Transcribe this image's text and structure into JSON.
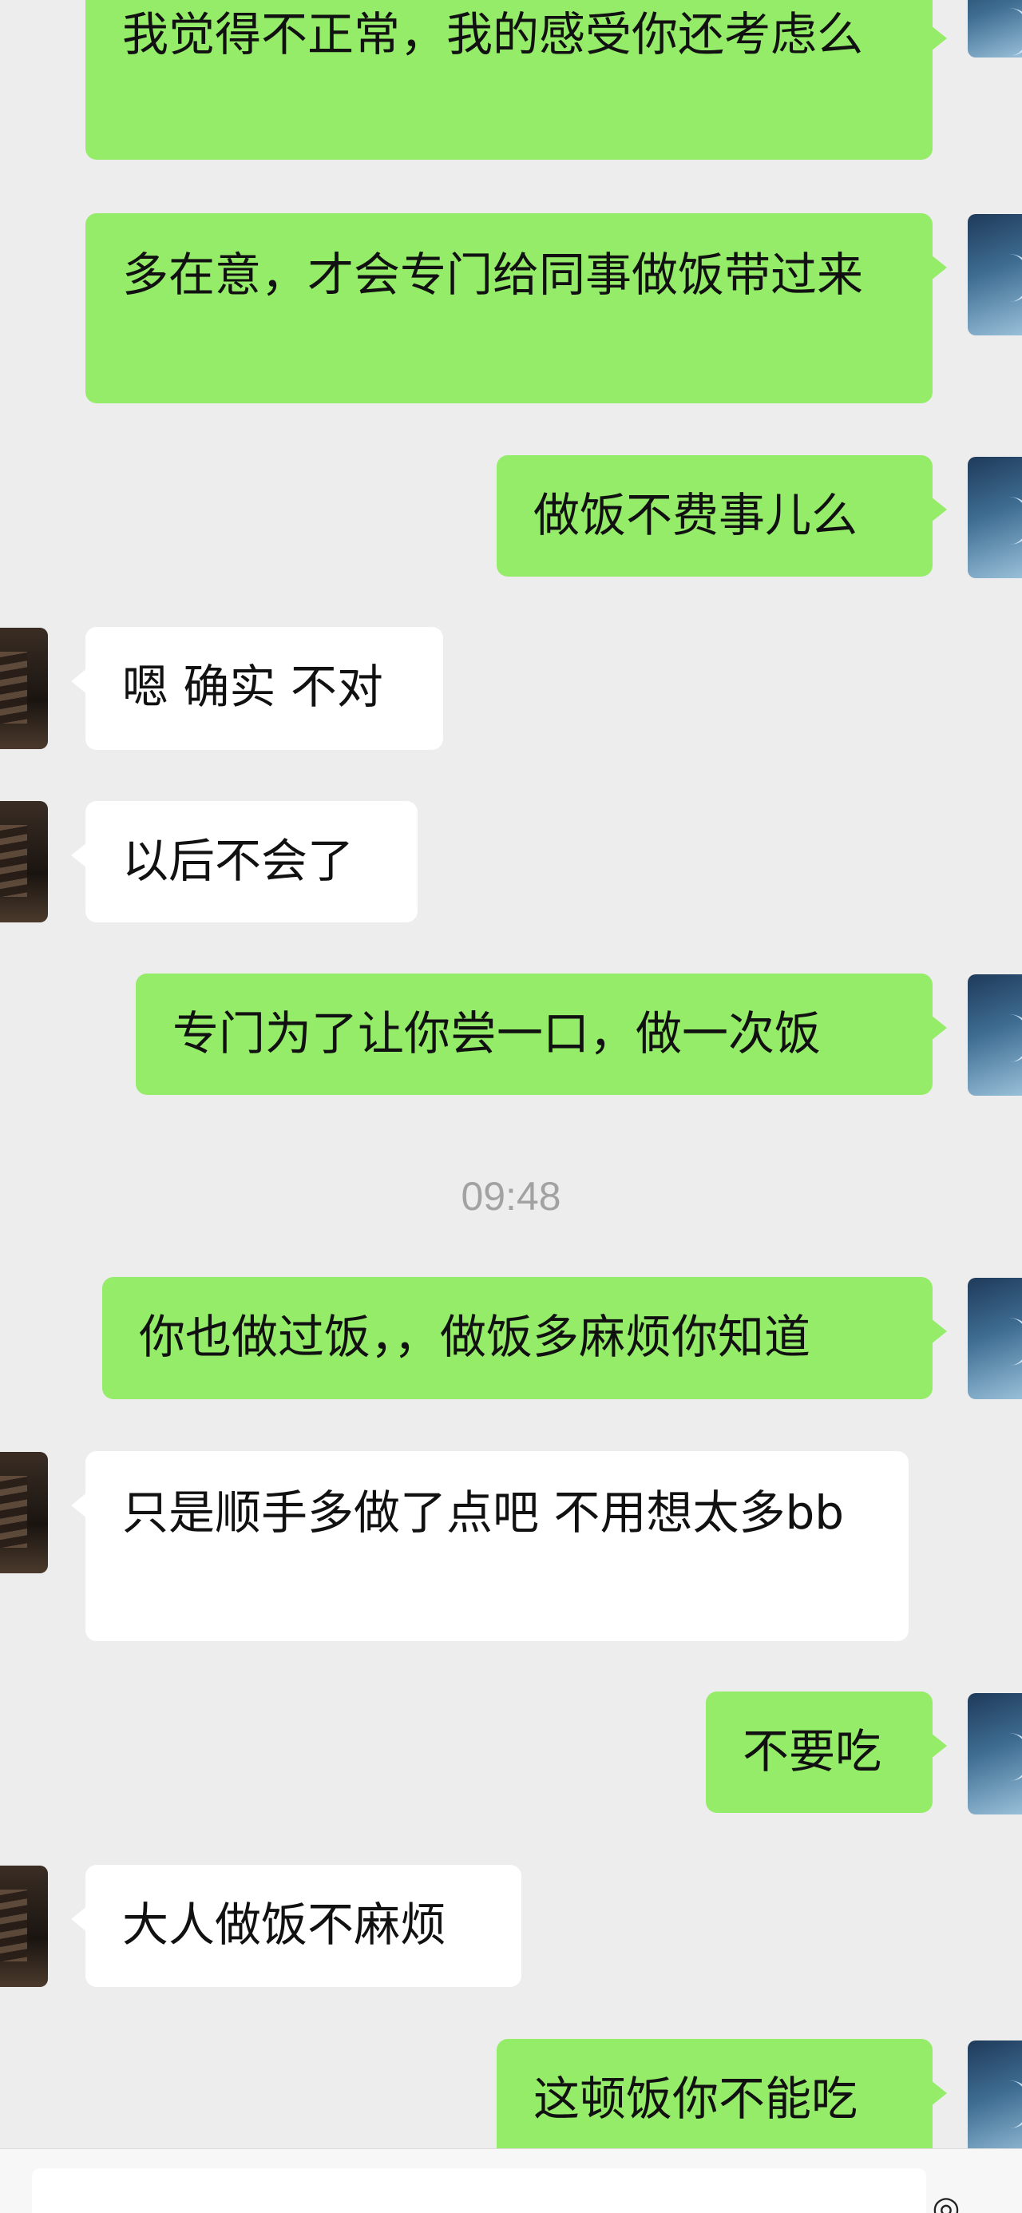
{
  "timestamp": "09:48",
  "messages": [
    {
      "sender": "self",
      "text": "我觉得不正常，我的感受你还考虑么"
    },
    {
      "sender": "self",
      "text": "多在意，才会专门给同事做饭带过来"
    },
    {
      "sender": "self",
      "text": "做饭不费事儿么"
    },
    {
      "sender": "other",
      "text": "嗯 确实 不对"
    },
    {
      "sender": "other",
      "text": "以后不会了"
    },
    {
      "sender": "self",
      "text": "专门为了让你尝一口，做一次饭"
    },
    {
      "sender": "self",
      "text": "你也做过饭，，做饭多麻烦你知道"
    },
    {
      "sender": "other",
      "text": "只是顺手多做了点吧 不用想太多bb"
    },
    {
      "sender": "self",
      "text": "不要吃"
    },
    {
      "sender": "other",
      "text": "大人做饭不麻烦"
    },
    {
      "sender": "self",
      "text": "这顿饭你不能吃"
    }
  ],
  "icons": {
    "self_avatar": "self-avatar",
    "other_avatar": "contact-avatar",
    "voice": "voice-icon"
  },
  "colors": {
    "outgoing_bubble": "#95ec69",
    "incoming_bubble": "#ffffff",
    "background": "#ededed",
    "timestamp": "#a2a2a2"
  }
}
